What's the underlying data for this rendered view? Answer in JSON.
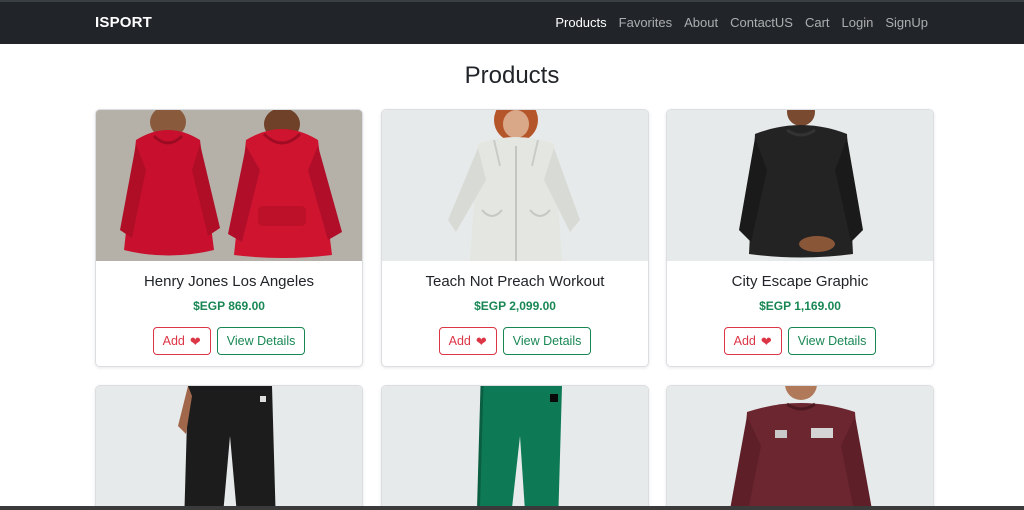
{
  "nav": {
    "brand": "ISPORT",
    "links": [
      "Products",
      "Favorites",
      "About",
      "ContactUS",
      "Cart",
      "Login",
      "SignUp"
    ],
    "active": "Products"
  },
  "page": {
    "title": "Products"
  },
  "buttons": {
    "add_label": "Add",
    "view_label": "View Details"
  },
  "products": [
    {
      "name": "Henry Jones Los Angeles",
      "price": "$EGP 869.00",
      "image": "red-hoodie",
      "color": "#c8102e"
    },
    {
      "name": "Teach Not Preach Workout",
      "price": "$EGP 2,099.00",
      "image": "white-zip-hoodie",
      "color": "#e6e8e3"
    },
    {
      "name": "City Escape Graphic",
      "price": "$EGP 1,169.00",
      "image": "black-sweatshirt",
      "color": "#222222"
    },
    {
      "name": "",
      "price": "",
      "image": "black-pants",
      "color": "#1c1c1c"
    },
    {
      "name": "",
      "price": "",
      "image": "green-pants",
      "color": "#0e7a55"
    },
    {
      "name": "",
      "price": "",
      "image": "maroon-sweatshirt",
      "color": "#6b2630"
    }
  ],
  "colors": {
    "navbar": "#212529",
    "price": "#198754",
    "add": "#dc3545",
    "view": "#198754"
  }
}
